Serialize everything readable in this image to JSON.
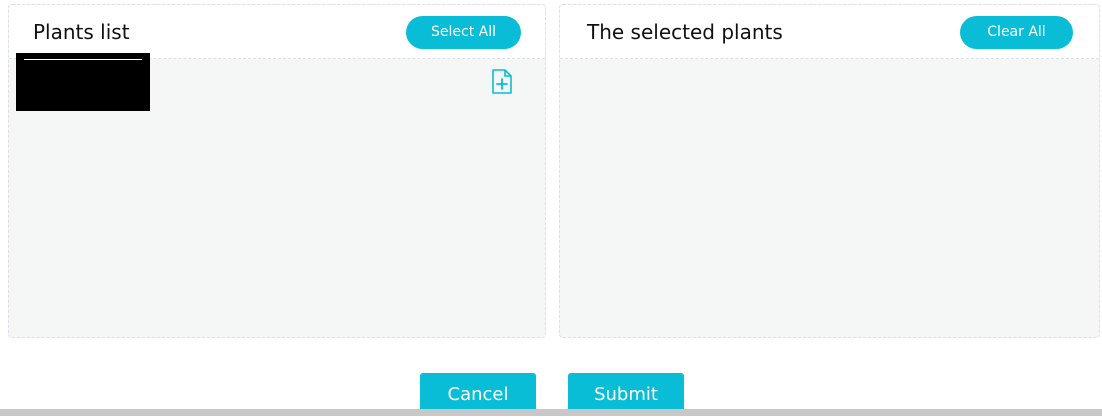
{
  "left_panel": {
    "title": "Plants list",
    "select_all_label": "Select All",
    "add_icon": "file-plus-icon"
  },
  "right_panel": {
    "title": "The selected plants",
    "clear_all_label": "Clear All"
  },
  "footer": {
    "cancel_label": "Cancel",
    "submit_label": "Submit"
  },
  "colors": {
    "accent": "#0abdd6",
    "panel_background": "#f5f6f6",
    "border": "#dcdfe6"
  }
}
